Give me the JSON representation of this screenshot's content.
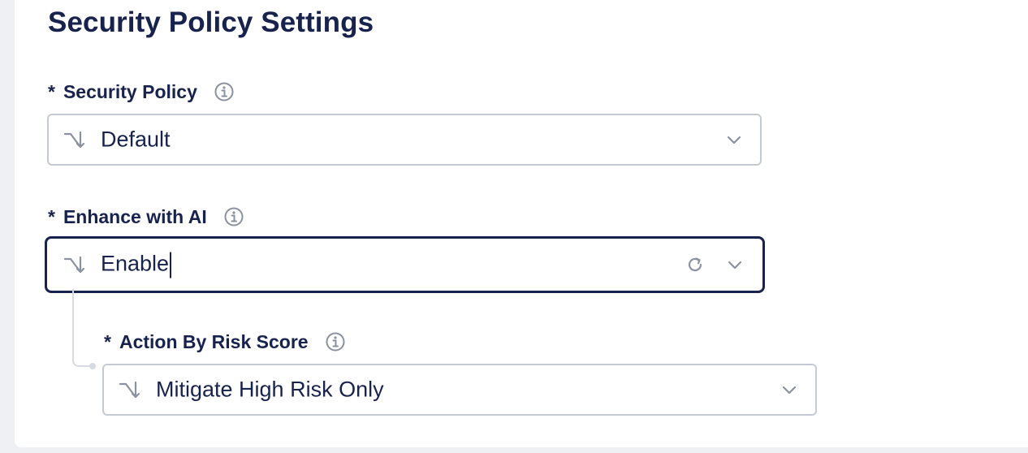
{
  "page": {
    "title": "Security Policy Settings"
  },
  "fields": {
    "security_policy": {
      "required_mark": "*",
      "label": "Security Policy",
      "value": "Default",
      "icon": "split-arrow-icon"
    },
    "enhance_ai": {
      "required_mark": "*",
      "label": "Enhance with AI",
      "value": "Enable",
      "icon": "split-arrow-icon",
      "focused": true
    },
    "action_risk": {
      "required_mark": "*",
      "label": "Action By Risk Score",
      "value": "Mitigate High Risk Only",
      "icon": "split-arrow-icon"
    }
  },
  "colors": {
    "text": "#17224d",
    "border": "#c5c9d3",
    "focus_border": "#17224d",
    "icon_gray": "#8b91a0",
    "background": "#eef0f3"
  }
}
